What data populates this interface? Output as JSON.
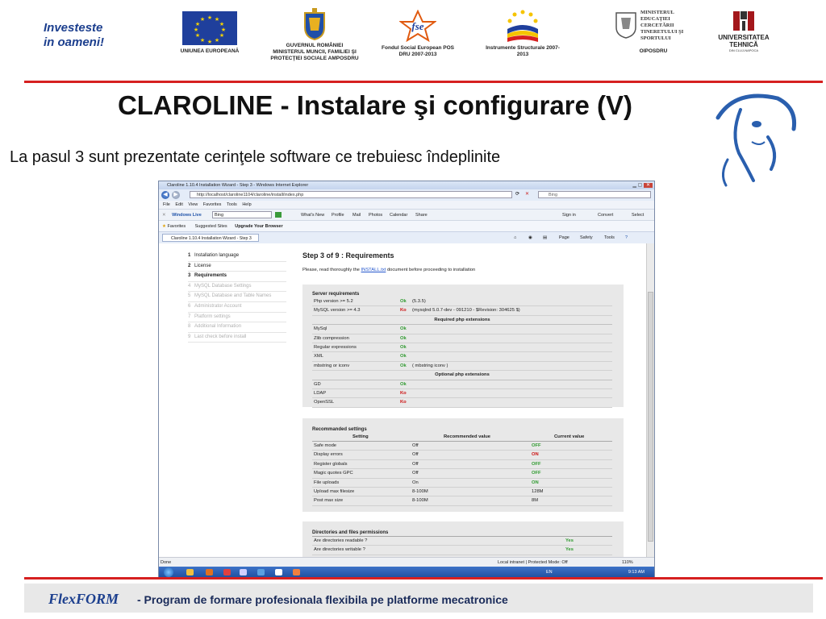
{
  "slide": {
    "slogan_line1": "Investeste",
    "slogan_line2": "in oameni!",
    "logos": [
      {
        "caption": "UNIUNEA EUROPEANĂ"
      },
      {
        "caption": "GUVERNUL ROMÂNIEI MINISTERUL MUNCII, FAMILIEI ŞI PROTECŢIEI SOCIALE AMPOSDRU"
      },
      {
        "caption": "Fondul Social European POS DRU 2007-2013"
      },
      {
        "caption": "Instrumente Structurale 2007-2013"
      },
      {
        "caption": "OIPOSDRU"
      },
      {
        "caption": "UNIVERSITATEA TEHNICĂ"
      }
    ],
    "ministry_text": "MINISTERUL EDUCAŢIEI CERCETĂRII TINERETULUI ŞI SPORTULUI",
    "fse_text": "fse",
    "utc_subtext": "DIN CLUJ-NAPOCA",
    "title": "CLAROLINE - Instalare şi configurare (V)",
    "subtitle": "La pasul 3 sunt prezentate cerinţele software ce trebuiesc îndeplinite",
    "footer_brand": "FlexFORM",
    "footer_text": "- Program de formare profesionala flexibila pe platforme mecatronice",
    "accent_red": "#d62020",
    "brand_blue": "#1c3f8e"
  },
  "browser": {
    "window_title": "Claroline 1.10.4 Installation Wizard - Step 3 - Windows Internet Explorer",
    "address": "http://localhost/claroline1104/claroline/install/index.php",
    "search_placeholder": "Bing",
    "menu": [
      "File",
      "Edit",
      "View",
      "Favorites",
      "Tools",
      "Help"
    ],
    "windows_live": "Windows Live",
    "wl_search": "Bing",
    "wl_links": [
      "What's New",
      "Profile",
      "Mail",
      "Photos",
      "Calendar",
      "Share"
    ],
    "sign_in": "Sign in",
    "convert": "Convert",
    "select": "Select",
    "favorites": "Favorites",
    "suggested_sites": "Suggested Sites",
    "upgrade_browser": "Upgrade Your Browser",
    "tab_title": "Claroline 1.10.4 Installation Wizard - Step 3",
    "cmd_page": "Page",
    "cmd_safety": "Safety",
    "cmd_tools": "Tools",
    "status_left": "Done",
    "status_zone": "Local intranet | Protected Mode: Off",
    "zoom": "110%",
    "lang": "EN",
    "time": "9:13 AM"
  },
  "wizard": {
    "steps": [
      {
        "num": "1",
        "label": "Installation language",
        "state": "done"
      },
      {
        "num": "2",
        "label": "License",
        "state": "done"
      },
      {
        "num": "3",
        "label": "Requirements",
        "state": "active"
      },
      {
        "num": "4",
        "label": "MySQL Database Settings",
        "state": "disabled"
      },
      {
        "num": "5",
        "label": "MySQL Database and Table Names",
        "state": "disabled"
      },
      {
        "num": "6",
        "label": "Administrator Account",
        "state": "disabled"
      },
      {
        "num": "7",
        "label": "Platform settings",
        "state": "disabled"
      },
      {
        "num": "8",
        "label": "Additional Information",
        "state": "disabled"
      },
      {
        "num": "9",
        "label": "Last check before install",
        "state": "disabled"
      }
    ],
    "heading": "Step 3 of 9 : Requirements",
    "intro_before": "Please, read thoroughly the ",
    "intro_link": "INSTALL.txt",
    "intro_after": " document before proceeding to installation",
    "server": {
      "title": "Server requirements",
      "rows": [
        {
          "name": "Php version >= 5.2",
          "status": "Ok",
          "detail": "(5.3.5)"
        },
        {
          "name": "MySQL version >= 4.3",
          "status": "Ko",
          "detail": "(mysqlnd 5.0.7-dev - 091210 - $Revision: 304625 $)"
        }
      ],
      "required_head": "Required php extensions",
      "required": [
        {
          "name": "MySql",
          "status": "Ok",
          "detail": ""
        },
        {
          "name": "Zlib compression",
          "status": "Ok",
          "detail": ""
        },
        {
          "name": "Regular expressions",
          "status": "Ok",
          "detail": ""
        },
        {
          "name": "XML",
          "status": "Ok",
          "detail": ""
        },
        {
          "name": "mbstring or iconv",
          "status": "Ok",
          "detail": "( mbstring iconv )"
        }
      ],
      "optional_head": "Optional php extensions",
      "optional": [
        {
          "name": "GD",
          "status": "Ok",
          "detail": ""
        },
        {
          "name": "LDAP",
          "status": "Ko",
          "detail": ""
        },
        {
          "name": "OpenSSL",
          "status": "Ko",
          "detail": ""
        }
      ]
    },
    "recommended": {
      "title": "Recommanded settings",
      "col_setting": "Setting",
      "col_recommended": "Recommended value",
      "col_current": "Current value",
      "rows": [
        {
          "setting": "Safe mode",
          "recommended": "Off",
          "current": "OFF",
          "ok": true
        },
        {
          "setting": "Display errors",
          "recommended": "Off",
          "current": "ON",
          "ok": false
        },
        {
          "setting": "Register globals",
          "recommended": "Off",
          "current": "OFF",
          "ok": true
        },
        {
          "setting": "Magic quotes GPC",
          "recommended": "Off",
          "current": "OFF",
          "ok": true
        },
        {
          "setting": "File uploads",
          "recommended": "On",
          "current": "ON",
          "ok": true
        },
        {
          "setting": "Upload max filesize",
          "recommended": "8-100M",
          "current": "128M",
          "ok": null
        },
        {
          "setting": "Post max size",
          "recommended": "8-100M",
          "current": "8M",
          "ok": null
        }
      ]
    },
    "dirs": {
      "title": "Directories and files permissions",
      "rows": [
        {
          "name": "Are directories readable ?",
          "status": "Yes"
        },
        {
          "name": "Are directories writable ?",
          "status": "Yes"
        }
      ]
    }
  }
}
